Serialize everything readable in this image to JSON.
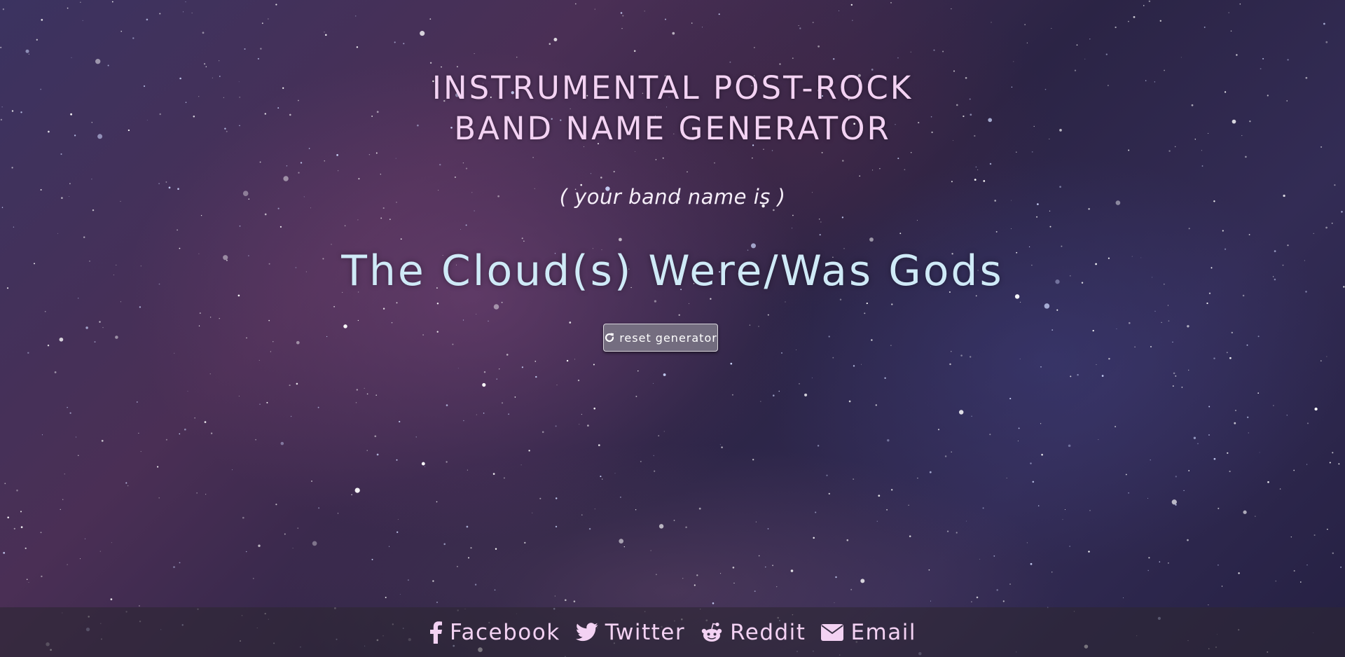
{
  "header": {
    "title_line1": "INSTRUMENTAL POST-ROCK",
    "title_line2": "BAND NAME GENERATOR"
  },
  "result": {
    "intro": "( your band name is )",
    "band_name": "The Cloud(s) Were/Was Gods"
  },
  "actions": {
    "reset_label": "reset generator",
    "reset_icon": "refresh-icon"
  },
  "footer": {
    "share_links": [
      {
        "label": "Facebook",
        "icon": "facebook-icon"
      },
      {
        "label": "Twitter",
        "icon": "twitter-icon"
      },
      {
        "label": "Reddit",
        "icon": "reddit-icon"
      },
      {
        "label": "Email",
        "icon": "envelope-icon"
      }
    ]
  },
  "colors": {
    "title": "#f3d2f3",
    "band_name": "#cfeaf7",
    "footer_text": "#f3d2f3"
  }
}
